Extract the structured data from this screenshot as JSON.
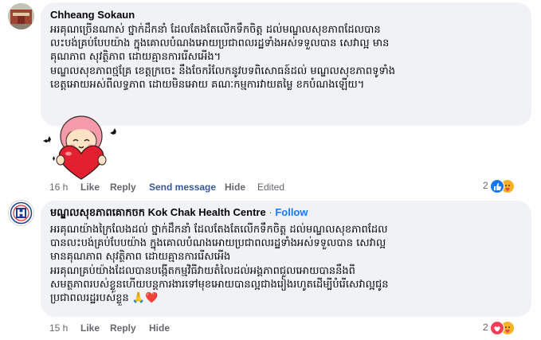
{
  "comments": [
    {
      "author": "Chheang Sokaun",
      "text": "អរគុណច្រើនណាស់ ថ្នាក់ដឹកនាំ ដែលតែងតែលើកទឹកចិត្ត ដល់មណ្ឌលសុខភាពដែលបាន\nលះបង់គ្រប់បែបយ៉ាង ក្នុងគោលបំណងអោយប្រជាពលរដ្ឋទាំងអស់ទទួលបាន សេវាល្អ មាន\nគុណភាព សុវត្ថិភាព ដោយគ្មានការរើសអើង។\nមណ្ឌលសុខភាពថ្មគ្រែ ខេត្តក្រចេះ នឹងចែករំលែកនូវបទពិសោធន៍ដល់ មណ្ឌលសុខភាពទូទាំង\nខេត្តអោយអស់ពីលទ្ធភាព ដោយមិនអោយ គណៈកម្មការវាយតម្លៃ ខកបំណងឡើយ។",
      "time": "16 h",
      "like": "Like",
      "reply": "Reply",
      "send_message": "Send message",
      "hide": "Hide",
      "edited": "Edited",
      "reaction_count": "2",
      "reactions": [
        "like-icon",
        "care-icon"
      ]
    },
    {
      "author": "មណ្ឌលសុខភាពគោកចក Kok Chak Health Centre",
      "follow": "Follow",
      "separator": "·",
      "text": "អរគុណយ៉ាងក្រៃលែងដល់ ថ្នាក់ដឹកនាំ ដែលតែងតែលើកទឹកចិត្ត ដល់មណ្ឌលសុខភាពដែល\nបានលះបង់គ្រប់បែបយ៉ាង ក្នុងគោលបំណងអោយប្រជាពលរដ្ឋទាំងអស់ទទួលបាន សេវាល្អ\nមានគុណភាព សុវត្ថិភាព ដោយគ្មានការរើសអើង\nអរគុណគ្រប់យ៉ាងដែលបានបង្កើតកម្មវិធីវាយតំលៃដល់អង្គភាពជួលអោយបាននឹងពី\nសមត្ថភាពរបស់ខ្លួនហើយបន្តការងារទៅមុខអោយបានល្អជាងរៀងរហូតដើម្បីបំរើសេវាល្អជូន\nប្រជាពលរដ្ឋរបស់ខ្លួន 🙏❤️",
      "time": "15 h",
      "like": "Like",
      "reply": "Reply",
      "hide": "Hide",
      "reaction_count": "2",
      "reactions": [
        "love-icon",
        "care-icon"
      ]
    }
  ],
  "colors": {
    "bubble": "#f0f2f5",
    "meta": "#65676b",
    "follow": "#1877f2",
    "like": "#1877f2",
    "love": "#f33e58",
    "care": "#f7b125"
  }
}
